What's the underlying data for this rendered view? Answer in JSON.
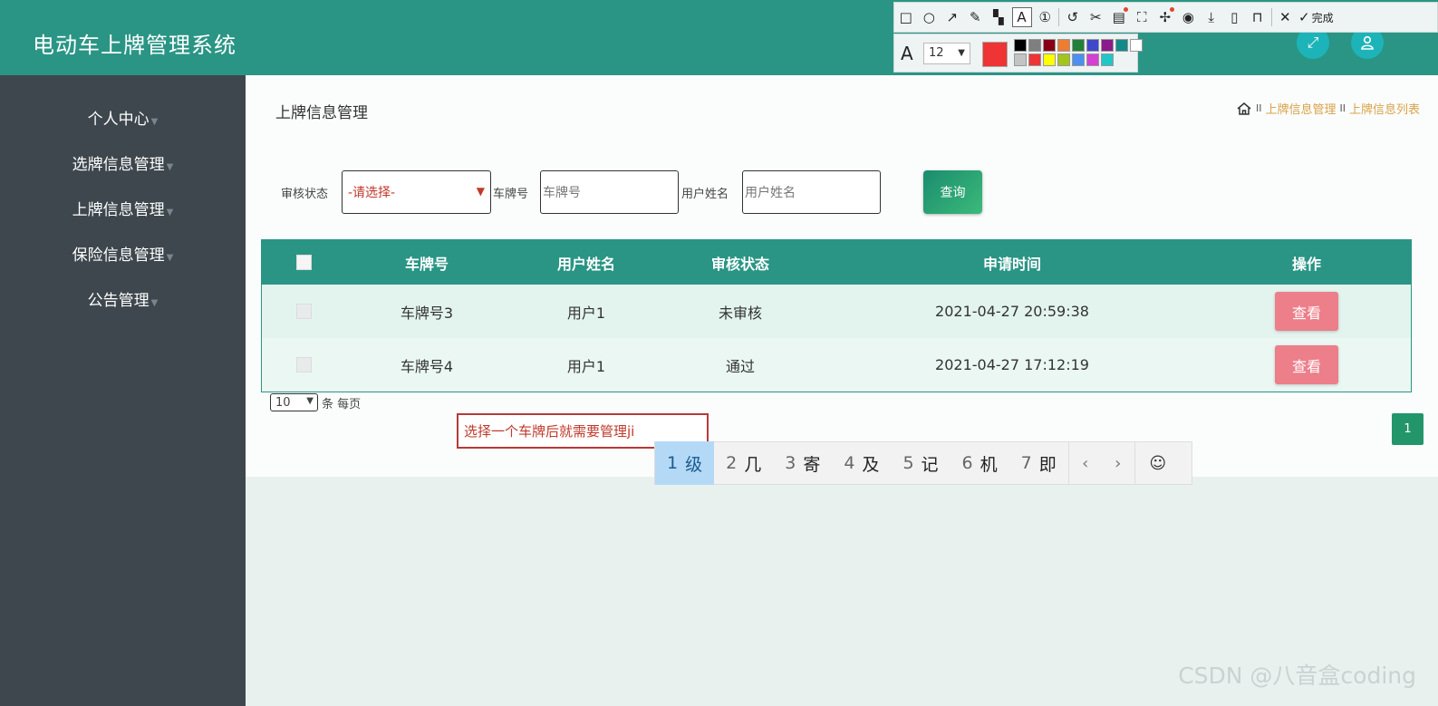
{
  "app": {
    "title": "电动车上牌管理系统"
  },
  "header": {
    "fullscreen_icon": "expand-icon",
    "user_icon": "user-icon"
  },
  "sidebar": {
    "items": [
      {
        "label": "个人中心"
      },
      {
        "label": "选牌信息管理"
      },
      {
        "label": "上牌信息管理"
      },
      {
        "label": "保险信息管理"
      },
      {
        "label": "公告管理"
      }
    ]
  },
  "page": {
    "title": "上牌信息管理"
  },
  "breadcrumb": {
    "sep": "II",
    "items": [
      "上牌信息管理",
      "上牌信息列表"
    ]
  },
  "search": {
    "status_label": "审核状态",
    "status_value": "-请选择-",
    "plate_label": "车牌号",
    "plate_placeholder": "车牌号",
    "name_label": "用户姓名",
    "name_placeholder": "用户姓名",
    "query_button": "查询"
  },
  "table": {
    "headers": [
      "车牌号",
      "用户姓名",
      "审核状态",
      "申请时间",
      "操作"
    ],
    "rows": [
      {
        "plate": "车牌号3",
        "user": "用户1",
        "status": "未审核",
        "time": "2021-04-27 20:59:38",
        "action": "查看"
      },
      {
        "plate": "车牌号4",
        "user": "用户1",
        "status": "通过",
        "time": "2021-04-27 17:12:19",
        "action": "查看"
      }
    ]
  },
  "pagination": {
    "page_size": "10",
    "per_page_label": "条 每页",
    "current_page": "1"
  },
  "annotation": {
    "text": "选择一个车牌后就需要管理ji"
  },
  "ime": {
    "candidates": [
      {
        "n": "1",
        "c": "级"
      },
      {
        "n": "2",
        "c": "几"
      },
      {
        "n": "3",
        "c": "寄"
      },
      {
        "n": "4",
        "c": "及"
      },
      {
        "n": "5",
        "c": "记"
      },
      {
        "n": "6",
        "c": "机"
      },
      {
        "n": "7",
        "c": "即"
      }
    ]
  },
  "toolbar": {
    "done_label": "完成",
    "font_size": "12",
    "current_color": "#ee3434",
    "palette": [
      "#000000",
      "#7f7f7f",
      "#880015",
      "#ed7d31",
      "#22803a",
      "#3f48cc",
      "#8b1a8b",
      "#138a8a",
      "#ffffff",
      "#c3c3c3",
      "#ee3434",
      "#ffff00",
      "#a3c41a",
      "#4b8ff0",
      "#d43fd4",
      "#22c6c6"
    ]
  },
  "watermark": {
    "text": "CSDN @八音盒coding"
  },
  "colors": {
    "header": "#2a9585",
    "sidebar": "#3e474d",
    "view_button": "#ec7f8a",
    "crumb": "#d8a24a"
  }
}
